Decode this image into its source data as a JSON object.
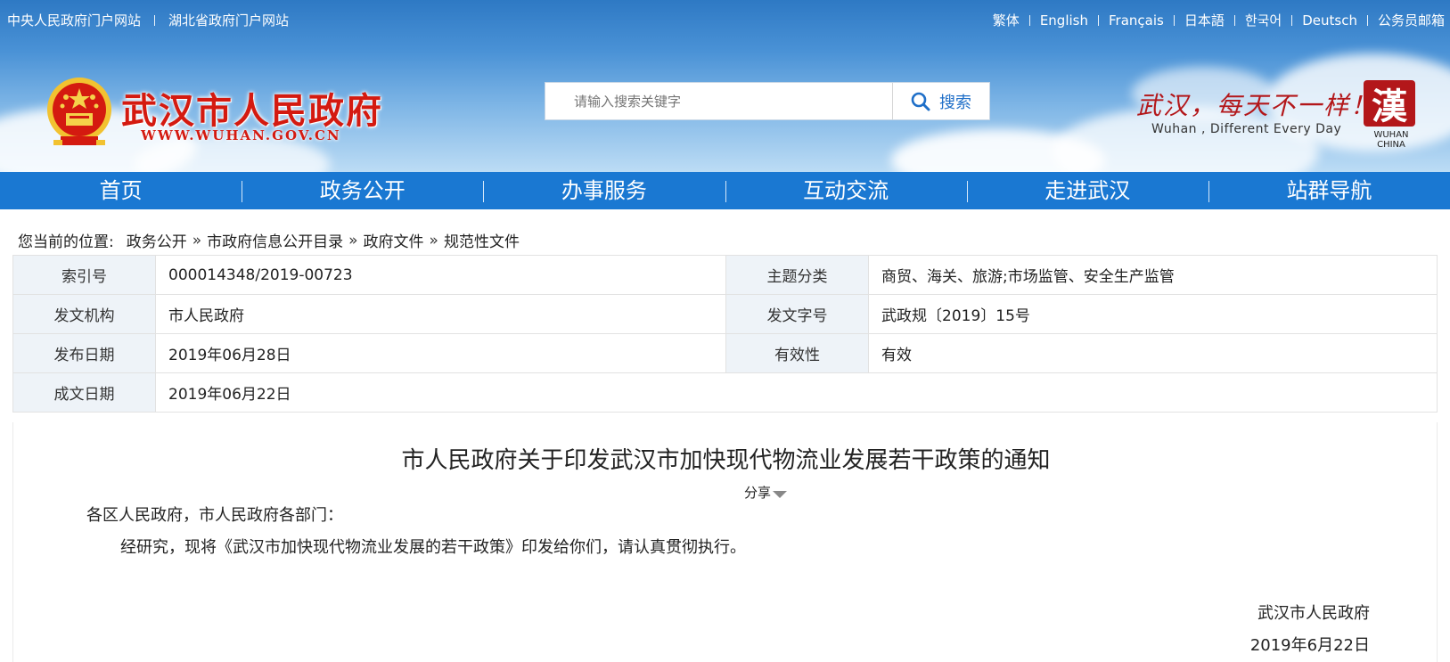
{
  "top_links": {
    "left": [
      "中央人民政府门户网站",
      "湖北省政府门户网站"
    ],
    "right": [
      "繁体",
      "English",
      "Français",
      "日本語",
      "한국어",
      "Deutsch",
      "公务员邮箱"
    ]
  },
  "header": {
    "site_title": "武汉市人民政府",
    "site_url": "WWW.WUHAN.GOV.CN",
    "search_placeholder": "请输入搜索关键字",
    "search_button": "搜索",
    "slogan": "武汉，每天不一样！",
    "slogan_en": "Wuhan , Different Every Day",
    "brand_mark": "漢",
    "brand_sub": [
      "WUHAN",
      "CHINA"
    ]
  },
  "nav": [
    "首页",
    "政务公开",
    "办事服务",
    "互动交流",
    "走进武汉",
    "站群导航"
  ],
  "breadcrumb": {
    "prefix": "您当前的位置:",
    "items": [
      "政务公开",
      "市政府信息公开目录",
      "政府文件",
      "规范性文件"
    ],
    "separator": "»"
  },
  "meta": {
    "index_label": "索引号",
    "index_value": "000014348/2019-00723",
    "topic_label": "主题分类",
    "topic_value": "商贸、海关、旅游;市场监管、安全生产监管",
    "issuer_label": "发文机构",
    "issuer_value": "市人民政府",
    "docno_label": "发文字号",
    "docno_value": "武政规〔2019〕15号",
    "pubdate_label": "发布日期",
    "pubdate_value": "2019年06月28日",
    "validity_label": "有效性",
    "validity_value": "有效",
    "created_label": "成文日期",
    "created_value": "2019年06月22日"
  },
  "document": {
    "title": "市人民政府关于印发武汉市加快现代物流业发展若干政策的通知",
    "share_label": "分享",
    "salutation": "各区人民政府，市人民政府各部门：",
    "body": "经研究，现将《武汉市加快现代物流业发展的若干政策》印发给你们，请认真贯彻执行。",
    "signature_org": "武汉市人民政府",
    "signature_date": "2019年6月22日"
  },
  "colors": {
    "nav_blue": "#1a78d2",
    "title_red": "#d41a10",
    "label_bg": "#eef3f8"
  }
}
